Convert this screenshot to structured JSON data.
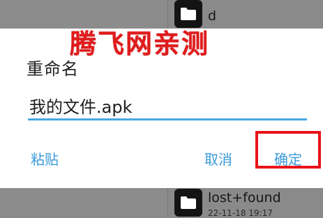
{
  "background": {
    "files": [
      {
        "name": "d",
        "meta": ""
      },
      {
        "name": "lost+found",
        "meta": "22-11-18 19:17"
      }
    ]
  },
  "dialog": {
    "title": "重命名",
    "input_value": "我的文件.apk",
    "paste_label": "粘贴",
    "cancel_label": "取消",
    "ok_label": "确定"
  },
  "watermark": {
    "text": "腾飞网亲测"
  },
  "colors": {
    "accent": "#47a7df",
    "button_text": "#3a9ad9",
    "highlight": "#e8141b",
    "watermark": "#e01c1c"
  }
}
